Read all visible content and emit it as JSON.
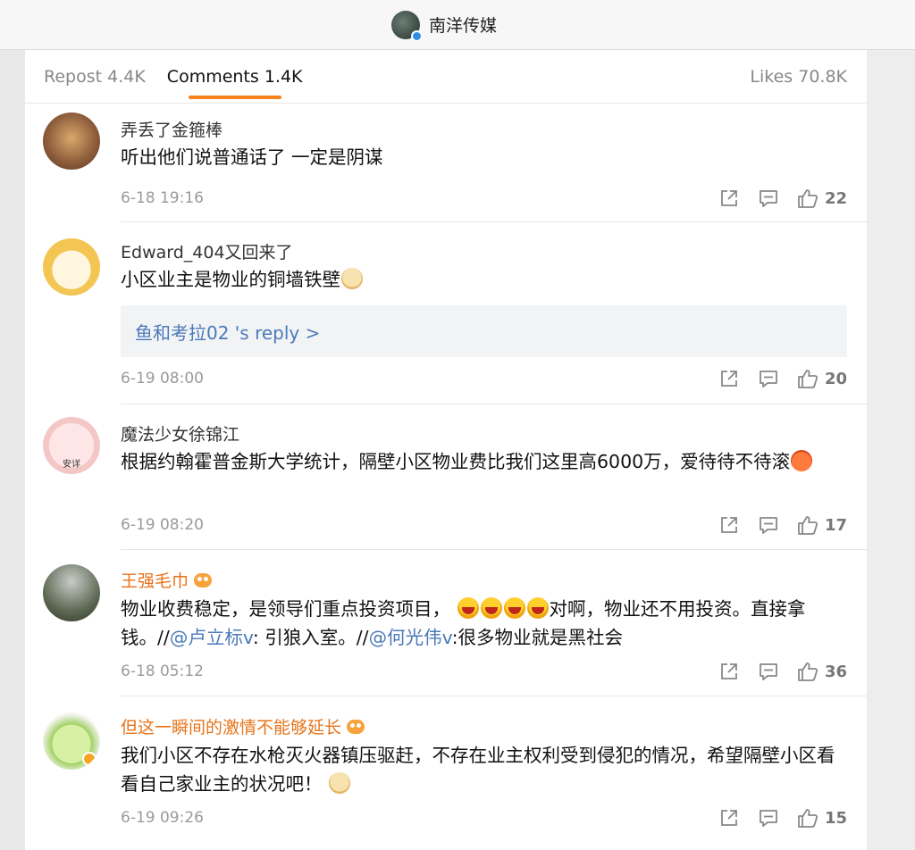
{
  "header": {
    "account_name": "南洋传媒"
  },
  "tabs": [
    {
      "label": "Repost 4.4K"
    },
    {
      "label": "Comments 1.4K"
    },
    {
      "label": "Likes 70.8K"
    }
  ],
  "comments": [
    {
      "user": "弄丢了金箍棒",
      "text": "听出他们说普通话了 一定是阴谋",
      "time": "6-18 19:16",
      "likes": "22"
    },
    {
      "user": "Edward_404又回来了",
      "text": "小区业主是物业的铜墙铁壁",
      "reply": "鱼和考拉02  's reply >",
      "time": "6-19 08:00",
      "likes": "20"
    },
    {
      "user": "魔法少女徐锦江",
      "text": "根据约翰霍普金斯大学统计，隔壁小区物业费比我们这里高6000万，爱待待不待滚",
      "avatar_text": "安详",
      "time": "6-19 08:20",
      "likes": "17"
    },
    {
      "user": "王强毛巾",
      "text_a": "物业收费稳定，是领导们重点投资项目，",
      "text_b": "对啊，物业还不用投资。直接拿钱。//",
      "mention_1": "@卢立标v",
      "text_c": ": 引狼入室。//",
      "mention_2": "@何光伟v",
      "text_d": ":很多物业就是黑社会",
      "time": "6-18 05:12",
      "likes": "36"
    },
    {
      "user": "但这一瞬间的激情不能够延长",
      "text": "我们小区不存在水枪灭火器镇压驱赶，不存在业主权利受到侵犯的情况，希望隔壁小区看看自己家业主的状况吧！",
      "time": "6-19 09:26",
      "likes": "15"
    }
  ],
  "icons": [
    "verified-icon",
    "share-icon",
    "reply-icon",
    "like-icon",
    "vip-icon",
    "doge-emoji",
    "angry-emoji",
    "laugh-emoji"
  ],
  "colors": {
    "accent": "#f7811a",
    "link": "#4a7ab8",
    "vip_name": "#e8731a"
  }
}
